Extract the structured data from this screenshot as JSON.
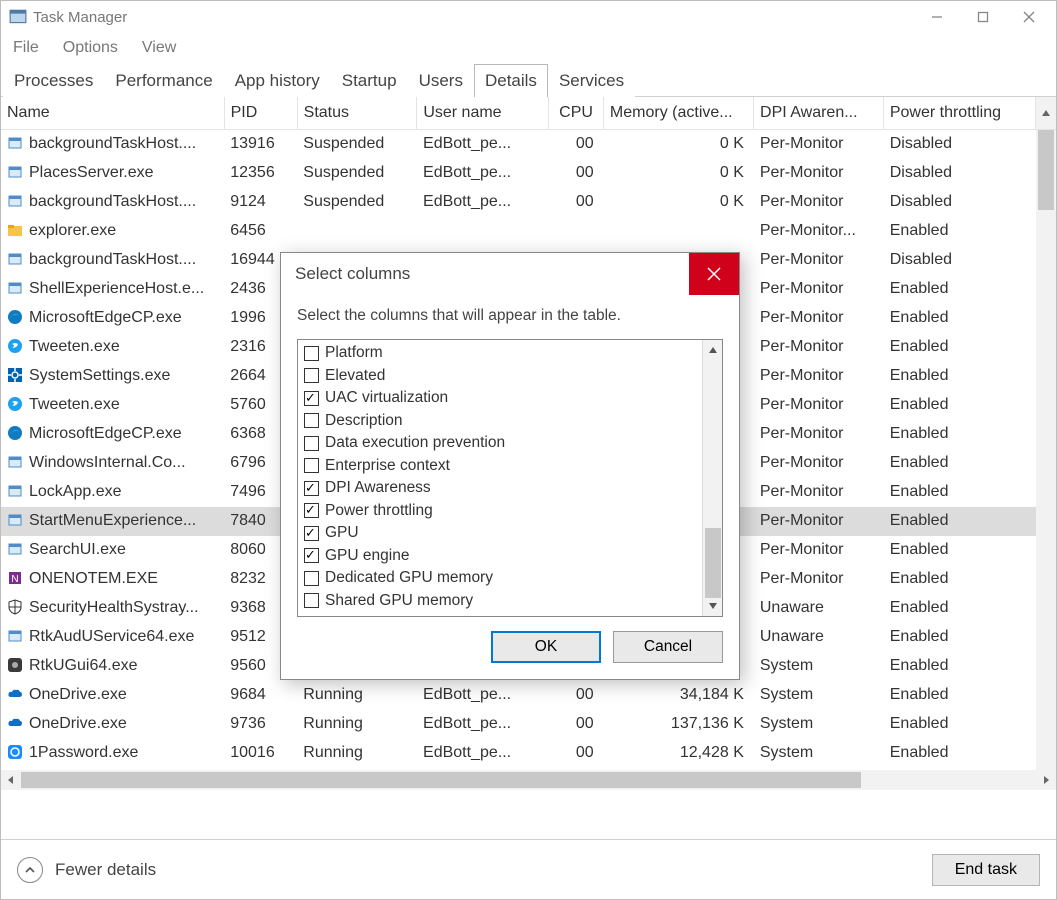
{
  "window": {
    "title": "Task Manager"
  },
  "menus": {
    "file": "File",
    "options": "Options",
    "view": "View"
  },
  "tabs": {
    "processes": "Processes",
    "performance": "Performance",
    "apphistory": "App history",
    "startup": "Startup",
    "users": "Users",
    "details": "Details",
    "services": "Services"
  },
  "columns": {
    "name": "Name",
    "pid": "PID",
    "status": "Status",
    "user": "User name",
    "cpu": "CPU",
    "memory": "Memory (active...",
    "dpi": "DPI Awaren...",
    "power": "Power throttling"
  },
  "rows": [
    {
      "icon": "app",
      "name": "backgroundTaskHost....",
      "pid": "13916",
      "status": "Suspended",
      "user": "EdBott_pe...",
      "cpu": "00",
      "mem": "0 K",
      "dpi": "Per-Monitor",
      "power": "Disabled"
    },
    {
      "icon": "app",
      "name": "PlacesServer.exe",
      "pid": "12356",
      "status": "Suspended",
      "user": "EdBott_pe...",
      "cpu": "00",
      "mem": "0 K",
      "dpi": "Per-Monitor",
      "power": "Disabled"
    },
    {
      "icon": "app",
      "name": "backgroundTaskHost....",
      "pid": "9124",
      "status": "Suspended",
      "user": "EdBott_pe...",
      "cpu": "00",
      "mem": "0 K",
      "dpi": "Per-Monitor",
      "power": "Disabled"
    },
    {
      "icon": "folder",
      "name": "explorer.exe",
      "pid": "6456",
      "status": "",
      "user": "",
      "cpu": "",
      "mem": "",
      "dpi": "Per-Monitor...",
      "power": "Enabled"
    },
    {
      "icon": "app",
      "name": "backgroundTaskHost....",
      "pid": "16944",
      "status": "",
      "user": "",
      "cpu": "",
      "mem": "",
      "dpi": "Per-Monitor",
      "power": "Disabled"
    },
    {
      "icon": "app",
      "name": "ShellExperienceHost.e...",
      "pid": "2436",
      "status": "",
      "user": "",
      "cpu": "",
      "mem": "",
      "dpi": "Per-Monitor",
      "power": "Enabled"
    },
    {
      "icon": "edge",
      "name": "MicrosoftEdgeCP.exe",
      "pid": "1996",
      "status": "",
      "user": "",
      "cpu": "",
      "mem": "",
      "dpi": "Per-Monitor",
      "power": "Enabled"
    },
    {
      "icon": "tweeten",
      "name": "Tweeten.exe",
      "pid": "2316",
      "status": "",
      "user": "",
      "cpu": "",
      "mem": "",
      "dpi": "Per-Monitor",
      "power": "Enabled"
    },
    {
      "icon": "settings",
      "name": "SystemSettings.exe",
      "pid": "2664",
      "status": "",
      "user": "",
      "cpu": "",
      "mem": "",
      "dpi": "Per-Monitor",
      "power": "Enabled"
    },
    {
      "icon": "tweeten",
      "name": "Tweeten.exe",
      "pid": "5760",
      "status": "",
      "user": "",
      "cpu": "",
      "mem": "",
      "dpi": "Per-Monitor",
      "power": "Enabled"
    },
    {
      "icon": "edge",
      "name": "MicrosoftEdgeCP.exe",
      "pid": "6368",
      "status": "",
      "user": "",
      "cpu": "",
      "mem": "",
      "dpi": "Per-Monitor",
      "power": "Enabled"
    },
    {
      "icon": "app",
      "name": "WindowsInternal.Co...",
      "pid": "6796",
      "status": "",
      "user": "",
      "cpu": "",
      "mem": "",
      "dpi": "Per-Monitor",
      "power": "Enabled"
    },
    {
      "icon": "app",
      "name": "LockApp.exe",
      "pid": "7496",
      "status": "",
      "user": "",
      "cpu": "",
      "mem": "",
      "dpi": "Per-Monitor",
      "power": "Enabled"
    },
    {
      "icon": "app",
      "name": "StartMenuExperience...",
      "pid": "7840",
      "status": "",
      "user": "",
      "cpu": "",
      "mem": "",
      "dpi": "Per-Monitor",
      "power": "Enabled",
      "selected": true
    },
    {
      "icon": "app",
      "name": "SearchUI.exe",
      "pid": "8060",
      "status": "",
      "user": "",
      "cpu": "",
      "mem": "",
      "dpi": "Per-Monitor",
      "power": "Enabled"
    },
    {
      "icon": "onenote",
      "name": "ONENOTEM.EXE",
      "pid": "8232",
      "status": "",
      "user": "",
      "cpu": "",
      "mem": "",
      "dpi": "Per-Monitor",
      "power": "Enabled"
    },
    {
      "icon": "shield",
      "name": "SecurityHealthSystray...",
      "pid": "9368",
      "status": "",
      "user": "",
      "cpu": "",
      "mem": "",
      "dpi": "Unaware",
      "power": "Enabled"
    },
    {
      "icon": "app",
      "name": "RtkAudUService64.exe",
      "pid": "9512",
      "status": "",
      "user": "",
      "cpu": "",
      "mem": "",
      "dpi": "Unaware",
      "power": "Enabled"
    },
    {
      "icon": "rtk",
      "name": "RtkUGui64.exe",
      "pid": "9560",
      "status": "",
      "user": "",
      "cpu": "",
      "mem": "",
      "dpi": "System",
      "power": "Enabled"
    },
    {
      "icon": "cloud",
      "name": "OneDrive.exe",
      "pid": "9684",
      "status": "Running",
      "user": "EdBott_pe...",
      "cpu": "00",
      "mem": "34,184 K",
      "dpi": "System",
      "power": "Enabled"
    },
    {
      "icon": "cloud",
      "name": "OneDrive.exe",
      "pid": "9736",
      "status": "Running",
      "user": "EdBott_pe...",
      "cpu": "00",
      "mem": "137,136 K",
      "dpi": "System",
      "power": "Enabled"
    },
    {
      "icon": "pw",
      "name": "1Password.exe",
      "pid": "10016",
      "status": "Running",
      "user": "EdBott_pe...",
      "cpu": "00",
      "mem": "12,428 K",
      "dpi": "System",
      "power": "Enabled"
    }
  ],
  "footer": {
    "fewer": "Fewer details",
    "endtask": "End task"
  },
  "dialog": {
    "title": "Select columns",
    "message": "Select the columns that will appear in the table.",
    "items": [
      {
        "label": "Platform",
        "checked": false
      },
      {
        "label": "Elevated",
        "checked": false
      },
      {
        "label": "UAC virtualization",
        "checked": true
      },
      {
        "label": "Description",
        "checked": false
      },
      {
        "label": "Data execution prevention",
        "checked": false
      },
      {
        "label": "Enterprise context",
        "checked": false
      },
      {
        "label": "DPI Awareness",
        "checked": true
      },
      {
        "label": "Power throttling",
        "checked": true
      },
      {
        "label": "GPU",
        "checked": true
      },
      {
        "label": "GPU engine",
        "checked": true
      },
      {
        "label": "Dedicated GPU memory",
        "checked": false
      },
      {
        "label": "Shared GPU memory",
        "checked": false
      }
    ],
    "ok": "OK",
    "cancel": "Cancel"
  }
}
